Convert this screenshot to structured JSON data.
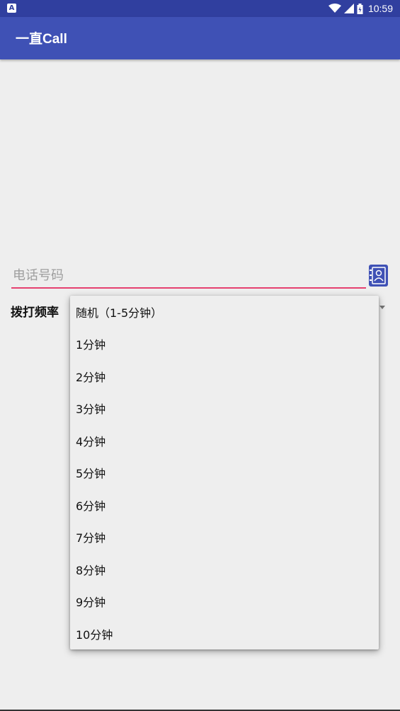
{
  "status_bar": {
    "notification_icon": "A",
    "time": "10:59",
    "icons": [
      "wifi-icon",
      "cell-signal-icon",
      "battery-icon"
    ]
  },
  "app_bar": {
    "title": "一直Call",
    "color": "#3f51b5"
  },
  "phone": {
    "placeholder": "电话号码",
    "value": "",
    "underline_color": "#e5406f"
  },
  "contacts_button": {
    "icon": "contacts-icon"
  },
  "frequency": {
    "label": "拨打频率",
    "options": [
      "随机（1-5分钟）",
      "1分钟",
      "2分钟",
      "3分钟",
      "4分钟",
      "5分钟",
      "6分钟",
      "7分钟",
      "8分钟",
      "9分钟",
      "10分钟"
    ]
  }
}
